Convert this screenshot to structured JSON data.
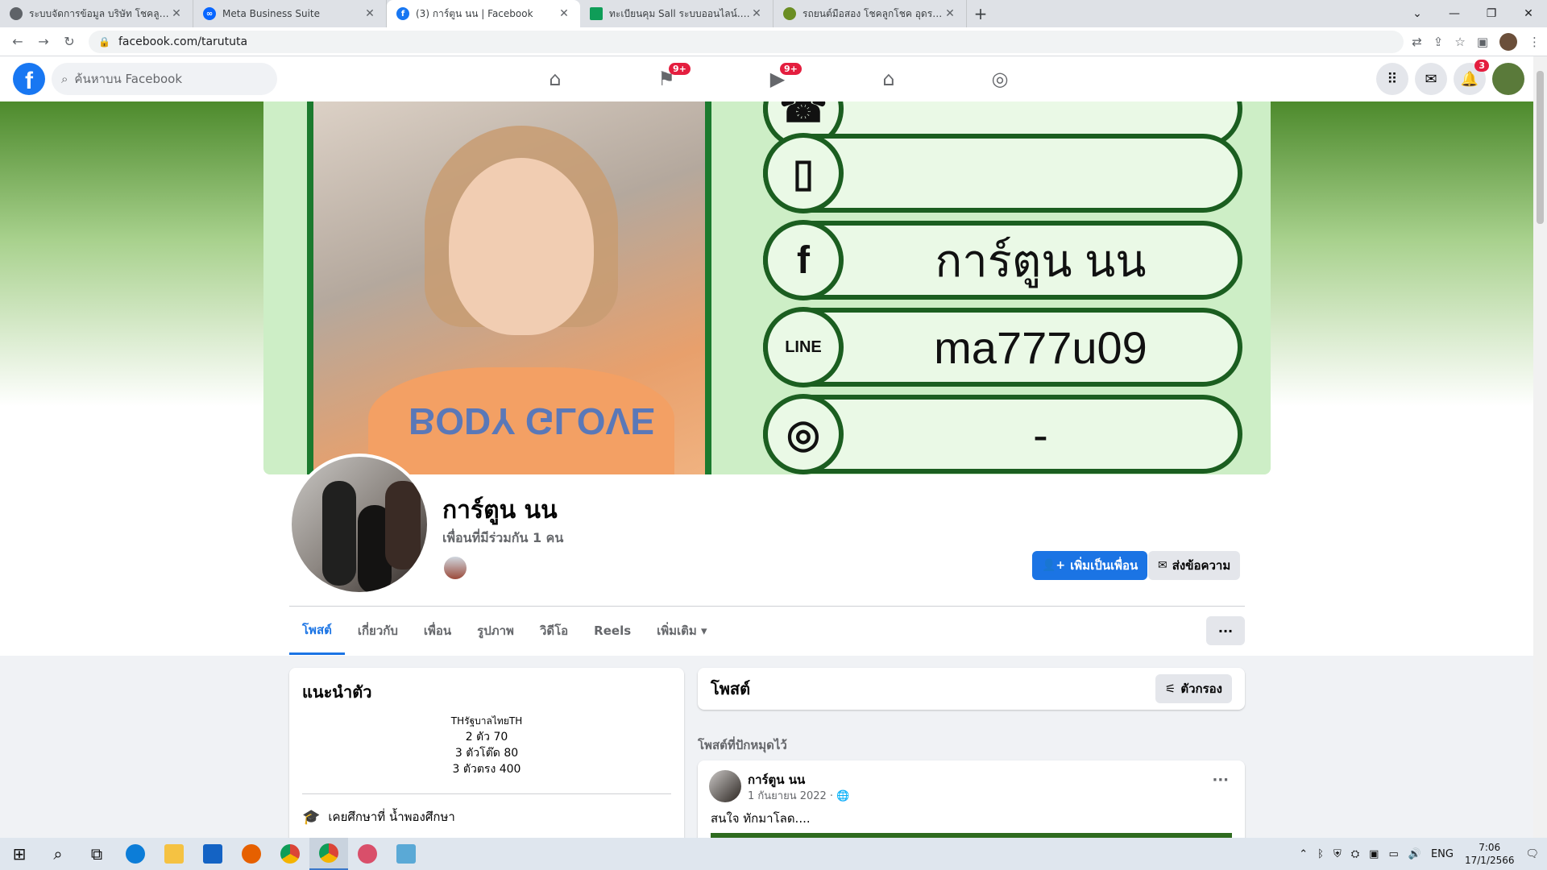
{
  "browser": {
    "tabs": [
      {
        "title": "ระบบจัดการข้อมูล บริษัท โชคลูกโชค",
        "favicon_color": "#5f6368",
        "active": false
      },
      {
        "title": "Meta Business Suite",
        "favicon_color": "#0866ff",
        "active": false
      },
      {
        "title": "(3) การ์ตูน นน | Facebook",
        "favicon_color": "#1877f2",
        "active": true
      },
      {
        "title": "ทะเบียนคุม Sall ระบบออนไลน์.xlsx - G",
        "favicon_color": "#0f9d58",
        "active": false
      },
      {
        "title": "รถยนต์มือสอง โชคลูกโชค อุดรธานี",
        "favicon_color": "#6b8e23",
        "active": false
      }
    ],
    "new_tab_label": "+",
    "url": "facebook.com/tarututa"
  },
  "facebook": {
    "logo_letter": "f",
    "search_placeholder": "ค้นหาบน Facebook",
    "nav": [
      {
        "icon": "home-icon",
        "glyph": "⌂",
        "badge": ""
      },
      {
        "icon": "flag-icon",
        "glyph": "⚑",
        "badge": "9+"
      },
      {
        "icon": "video-icon",
        "glyph": "▶",
        "badge": "9+"
      },
      {
        "icon": "marketplace-icon",
        "glyph": "⌂",
        "badge": ""
      },
      {
        "icon": "gaming-icon",
        "glyph": "◎",
        "badge": ""
      }
    ],
    "notifications_badge": "3"
  },
  "cover": {
    "shirt_text": "BODY GLOVE",
    "contact_rows": [
      {
        "icon": "phone-icon",
        "glyph": "▯",
        "text": ""
      },
      {
        "icon": "facebook-icon",
        "glyph": "f",
        "text": "การ์ตูน นน"
      },
      {
        "icon": "line-icon",
        "glyph": "LINE",
        "text": "ma777u09"
      },
      {
        "icon": "instagram-icon",
        "glyph": "◎",
        "text": "-"
      }
    ]
  },
  "profile": {
    "name": "การ์ตูน นน",
    "mutual_friends": "เพื่อนที่มีร่วมกัน 1 คน",
    "add_friend_label": "เพิ่มเป็นเพื่อน",
    "message_label": "ส่งข้อความ",
    "tabs": [
      "โพสต์",
      "เกี่ยวกับ",
      "เพื่อน",
      "รูปภาพ",
      "วิดีโอ",
      "Reels",
      "เพิ่มเติม ▾"
    ],
    "more_label": "···"
  },
  "intro": {
    "title": "แนะนำตัว",
    "bio_lines": [
      "THรัฐบาลไทยTH",
      "2 ตัว 70",
      "3 ตัวโต๊ด 80",
      "3 ตัวตรง 400"
    ],
    "education": "เคยศึกษาที่ น้ำพองศึกษา"
  },
  "posts": {
    "title": "โพสต์",
    "filter_label": "ตัวกรอง",
    "pinned_label": "โพสต์ที่ปักหมุดไว้",
    "post": {
      "author": "การ์ตูน นน",
      "date": "1 กันยายน 2022 · 🌐",
      "text": "สนใจ  ทักมาโลด...."
    }
  },
  "taskbar": {
    "lang": "ENG",
    "time": "7:06",
    "date": "17/1/2566"
  }
}
